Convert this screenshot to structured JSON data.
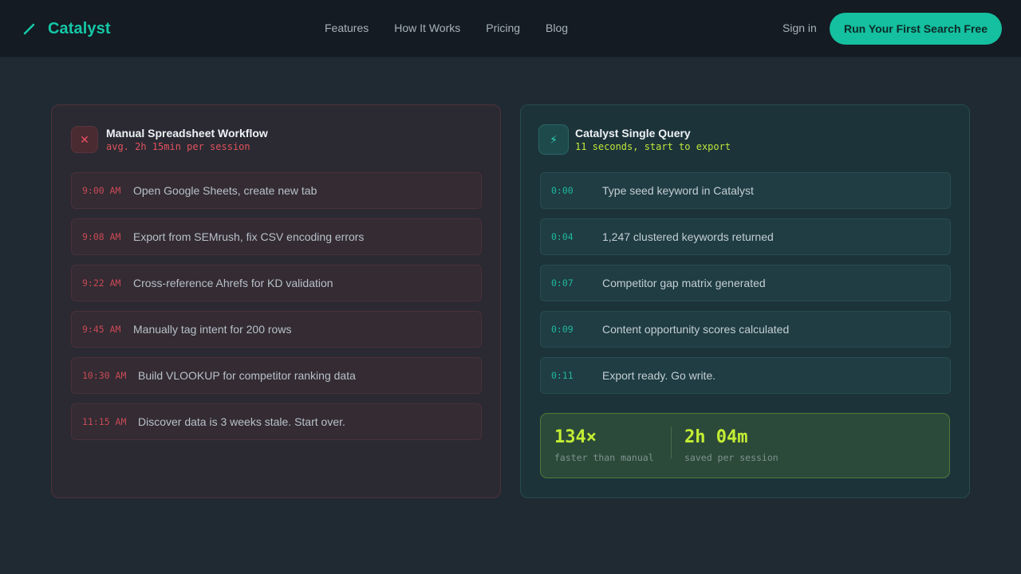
{
  "nav": {
    "brand": "Catalyst",
    "links": [
      "Features",
      "How It Works",
      "Pricing",
      "Blog"
    ],
    "signin": "Sign in",
    "cta": "Run Your First Search Free"
  },
  "manual": {
    "title": "Manual Spreadsheet Workflow",
    "subtitle": "avg. 2h 15min per session",
    "steps": [
      {
        "time": "9:00 AM",
        "text": "Open Google Sheets, create new tab"
      },
      {
        "time": "9:08 AM",
        "text": "Export from SEMrush, fix CSV encoding errors"
      },
      {
        "time": "9:22 AM",
        "text": "Cross-reference Ahrefs for KD validation"
      },
      {
        "time": "9:45 AM",
        "text": "Manually tag intent for 200 rows"
      },
      {
        "time": "10:30 AM",
        "text": "Build VLOOKUP for competitor ranking data"
      },
      {
        "time": "11:15 AM",
        "text": "Discover data is 3 weeks stale. Start over."
      }
    ]
  },
  "catalyst": {
    "title": "Catalyst Single Query",
    "subtitle": "11 seconds, start to export",
    "steps": [
      {
        "time": "0:00",
        "text": "Type seed keyword in Catalyst"
      },
      {
        "time": "0:04",
        "text": "1,247 clustered keywords returned"
      },
      {
        "time": "0:07",
        "text": "Competitor gap matrix generated"
      },
      {
        "time": "0:09",
        "text": "Content opportunity scores calculated"
      },
      {
        "time": "0:11",
        "text": "Export ready. Go write."
      }
    ],
    "stats": [
      {
        "value": "134×",
        "label": "faster than manual"
      },
      {
        "value": "2h 04m",
        "label": "saved per session"
      }
    ]
  },
  "icons": {
    "brand": "slash-pen-icon",
    "manual": "close-icon",
    "catalyst": "lightning-bolt-icon"
  },
  "colors": {
    "accent": "#14c0a0",
    "danger": "#e0525c",
    "highlight": "#c4ee33"
  }
}
